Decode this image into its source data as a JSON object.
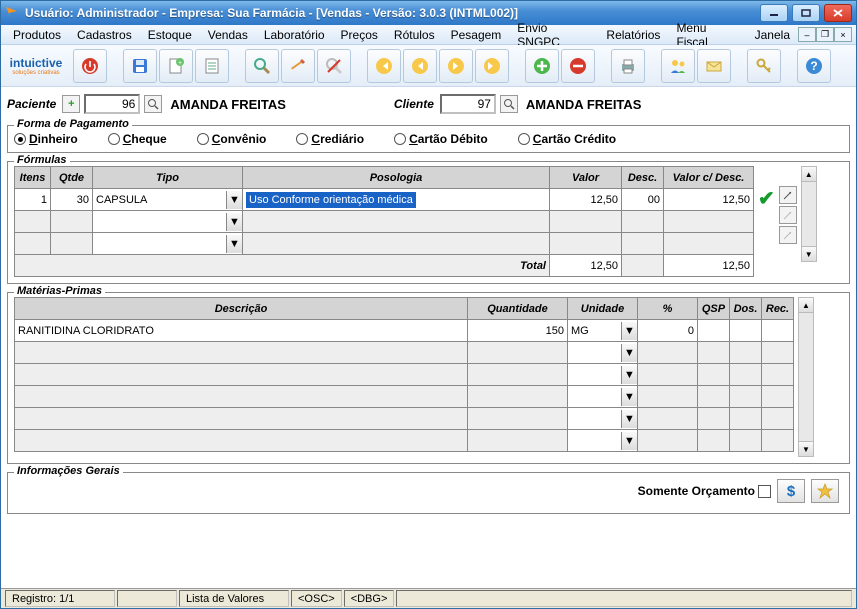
{
  "title": "Usuário: Administrador - Empresa: Sua Farmácia - [Vendas - Versão: 3.0.3 (INTML002)]",
  "menu": [
    "Produtos",
    "Cadastros",
    "Estoque",
    "Vendas",
    "Laboratório",
    "Preços",
    "Rótulos",
    "Pesagem",
    "Envio SNGPC",
    "Relatórios",
    "Menu Fiscal",
    "Janela"
  ],
  "logo": {
    "brand": "intuictive",
    "tag": "soluções criativas"
  },
  "patient": {
    "label": "Paciente",
    "id": "96",
    "name": "AMANDA FREITAS"
  },
  "client": {
    "label": "Cliente",
    "id": "97",
    "name": "AMANDA FREITAS"
  },
  "payment": {
    "legend": "Forma de Pagamento",
    "options": [
      {
        "label": "Dinheiro",
        "accel": "D",
        "selected": true
      },
      {
        "label": "Cheque",
        "accel": "C",
        "selected": false
      },
      {
        "label": "Convênio",
        "accel": "C",
        "selected": false
      },
      {
        "label": "Crediário",
        "accel": "C",
        "selected": false
      },
      {
        "label": "Cartão Débito",
        "accel": "C",
        "selected": false
      },
      {
        "label": "Cartão Crédito",
        "accel": "C",
        "selected": false
      }
    ]
  },
  "formulas": {
    "legend": "Fórmulas",
    "headers": [
      "Itens",
      "Qtde",
      "Tipo",
      "Posologia",
      "Valor",
      "Desc.",
      "Valor c/ Desc."
    ],
    "rows": [
      {
        "itens": "1",
        "qtde": "30",
        "tipo": "CAPSULA",
        "posologia": "Uso Conforme orientação médica",
        "valor": "12,50",
        "desc": "00",
        "valor_desc": "12,50"
      }
    ],
    "total_label": "Total",
    "total_valor": "12,50",
    "total_valor_desc": "12,50"
  },
  "materias": {
    "legend": "Matérias-Primas",
    "headers": [
      "Descrição",
      "Quantidade",
      "Unidade",
      "%",
      "QSP",
      "Dos.",
      "Rec."
    ],
    "rows": [
      {
        "descricao": "RANITIDINA CLORIDRATO",
        "quantidade": "150",
        "unidade": "MG",
        "pct": "0",
        "qsp": "",
        "dos": "",
        "rec": ""
      }
    ]
  },
  "info": {
    "legend": "Informações Gerais"
  },
  "footer": {
    "somente_orcamento": "Somente Orçamento"
  },
  "status": {
    "registro": "Registro: 1/1",
    "lista": "Lista de Valores",
    "osc": "<OSC>",
    "dbg": "<DBG>"
  }
}
